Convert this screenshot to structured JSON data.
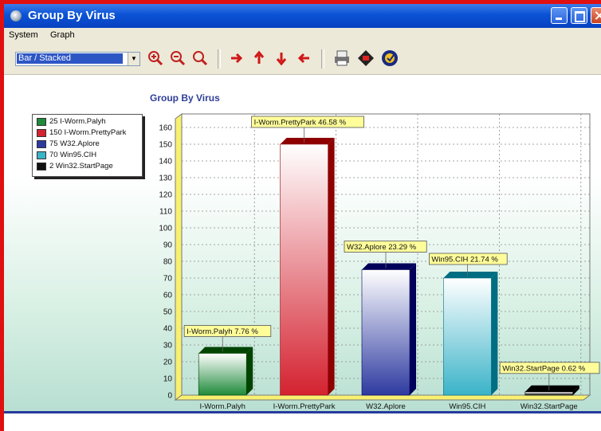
{
  "window": {
    "title": "Group By Virus"
  },
  "menu": {
    "items": [
      "System",
      "Graph"
    ]
  },
  "toolbar": {
    "chart_type": "Bar / Stacked",
    "buttons": [
      "zoom-in-icon",
      "zoom-out-icon",
      "zoom-reset-icon",
      "arrow-right-icon",
      "arrow-up-icon",
      "arrow-down-icon",
      "arrow-left-icon",
      "print-icon",
      "export-icon",
      "settings-icon"
    ]
  },
  "colors": {
    "title_bar": "#0a52d6",
    "frame": "#e01010",
    "chart_title": "#2f3f99"
  },
  "chart_data": {
    "type": "bar",
    "title": "Group By Virus",
    "categories": [
      "I-Worm.Palyh",
      "I-Worm.PrettyPark",
      "W32.Aplore",
      "Win95.CIH",
      "Win32.StartPage"
    ],
    "values": [
      25,
      150,
      75,
      70,
      2
    ],
    "colors": [
      "#1f8a3a",
      "#d42230",
      "#2e3aa0",
      "#3ab3c8",
      "#111111"
    ],
    "data_labels": [
      "I-Worm.Palyh 7.76 %",
      "I-Worm.PrettyPark 46.58 %",
      "W32.Aplore 23.29 %",
      "Win95.CIH 21.74 %",
      "Win32.StartPage 0.62 %"
    ],
    "legend": [
      "25 I-Worm.Palyh",
      "150 I-Worm.PrettyPark",
      "75 W32.Aplore",
      "70 Win95.CIH",
      "2 Win32.StartPage"
    ],
    "yticks": [
      "0",
      "10",
      "20",
      "30",
      "40",
      "50",
      "60",
      "70",
      "80",
      "90",
      "100",
      "110",
      "120",
      "130",
      "140",
      "150",
      "160"
    ],
    "ylim": [
      0,
      160
    ],
    "grid": true,
    "legend_position": "top-left"
  }
}
